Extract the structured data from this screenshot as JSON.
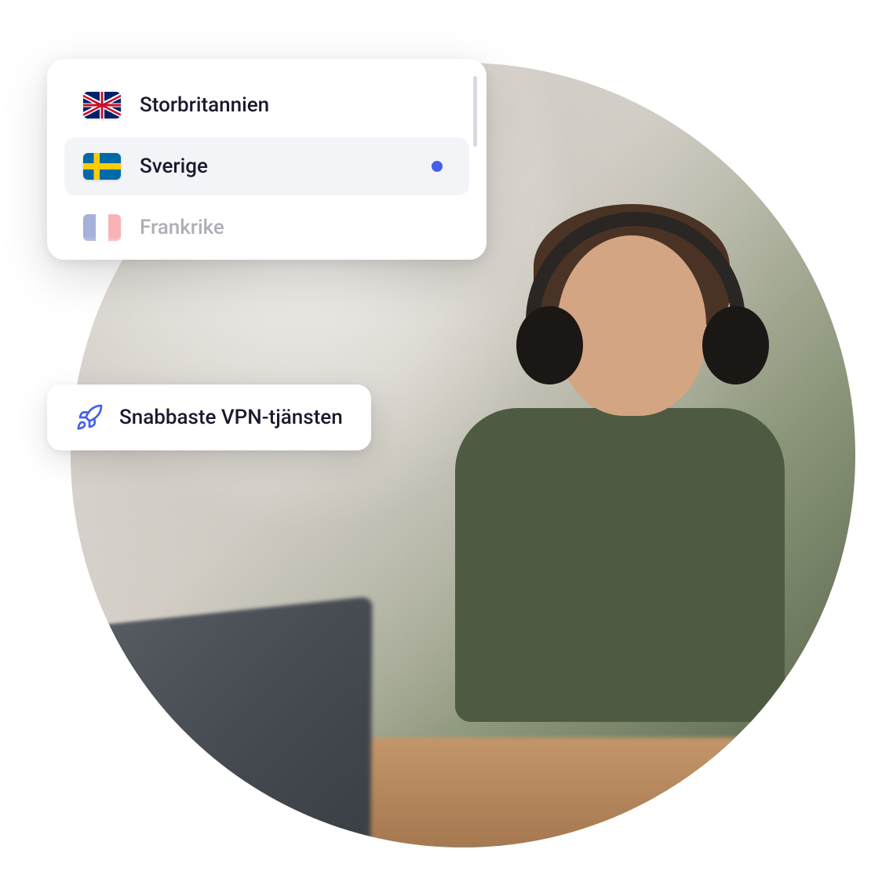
{
  "countryList": {
    "items": [
      {
        "label": "Storbritannien",
        "flag": "uk",
        "selected": false,
        "faded": false
      },
      {
        "label": "Sverige",
        "flag": "se",
        "selected": true,
        "faded": false
      },
      {
        "label": "Frankrike",
        "flag": "fr",
        "selected": false,
        "faded": true
      }
    ]
  },
  "badge": {
    "text": "Snabbaste VPN-tjänsten",
    "iconName": "rocket-icon"
  },
  "colors": {
    "accent": "#4361ee",
    "selectedBg": "#f3f4f7",
    "text": "#1a1a2e"
  }
}
